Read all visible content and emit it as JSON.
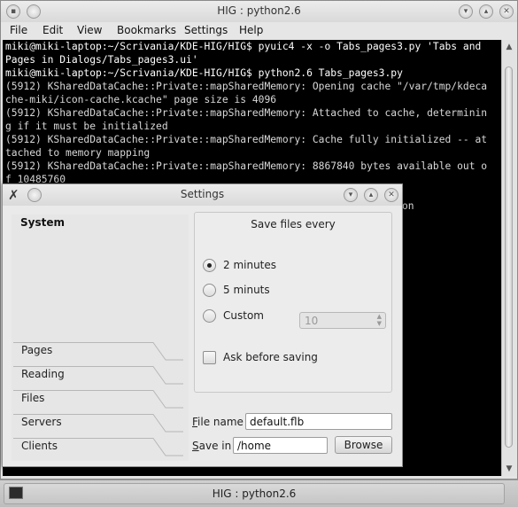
{
  "window": {
    "title": "HIG : python2.6",
    "menu": [
      "File",
      "Edit",
      "View",
      "Bookmarks",
      "Settings",
      "Help"
    ]
  },
  "terminal": {
    "lines": [
      {
        "text": "miki@miki-laptop:~/Scrivania/KDE-HIG/HIG$ pyuic4 -x -o Tabs_pages3.py 'Tabs and",
        "bright": true
      },
      {
        "text": "Pages in Dialogs/Tabs_pages3.ui'",
        "bright": true
      },
      {
        "text": "miki@miki-laptop:~/Scrivania/KDE-HIG/HIG$ python2.6 Tabs_pages3.py",
        "bright": true
      },
      {
        "text": "(5912) KSharedDataCache::Private::mapSharedMemory: Opening cache \"/var/tmp/kdeca",
        "bright": false
      },
      {
        "text": "che-miki/icon-cache.kcache\" page size is 4096",
        "bright": false
      },
      {
        "text": "(5912) KSharedDataCache::Private::mapSharedMemory: Attached to cache, determinin",
        "bright": false
      },
      {
        "text": "g if it must be initialized",
        "bright": false
      },
      {
        "text": "(5912) KSharedDataCache::Private::mapSharedMemory: Cache fully initialized -- at",
        "bright": false
      },
      {
        "text": "tached to memory mapping",
        "bright": false
      },
      {
        "text": "(5912) KSharedDataCache::Private::mapSharedMemory: 8867840 bytes available out o",
        "bright": false
      },
      {
        "text": "f 10485760",
        "bright": false
      }
    ],
    "obscured_fragment": "on"
  },
  "taskbar": {
    "task_label": "HIG : python2.6"
  },
  "dialog": {
    "title": "Settings",
    "sidebar": {
      "current": "System",
      "tabs": [
        "Pages",
        "Reading",
        "Files",
        "Servers",
        "Clients"
      ]
    },
    "group": {
      "title": "Save files every",
      "options": [
        {
          "label": "2 minutes",
          "selected": true
        },
        {
          "label": "5 minuts",
          "selected": false
        },
        {
          "label": "Custom",
          "selected": false
        }
      ],
      "custom_value": "10",
      "ask_before_saving": {
        "label": "Ask before saving",
        "checked": false
      }
    },
    "file_name": {
      "label_first": "F",
      "label_rest": "ile name",
      "value": "default.flb"
    },
    "save_in": {
      "label_first": "S",
      "label_rest": "ave in",
      "value": "/home"
    },
    "browse_label": "Browse"
  }
}
